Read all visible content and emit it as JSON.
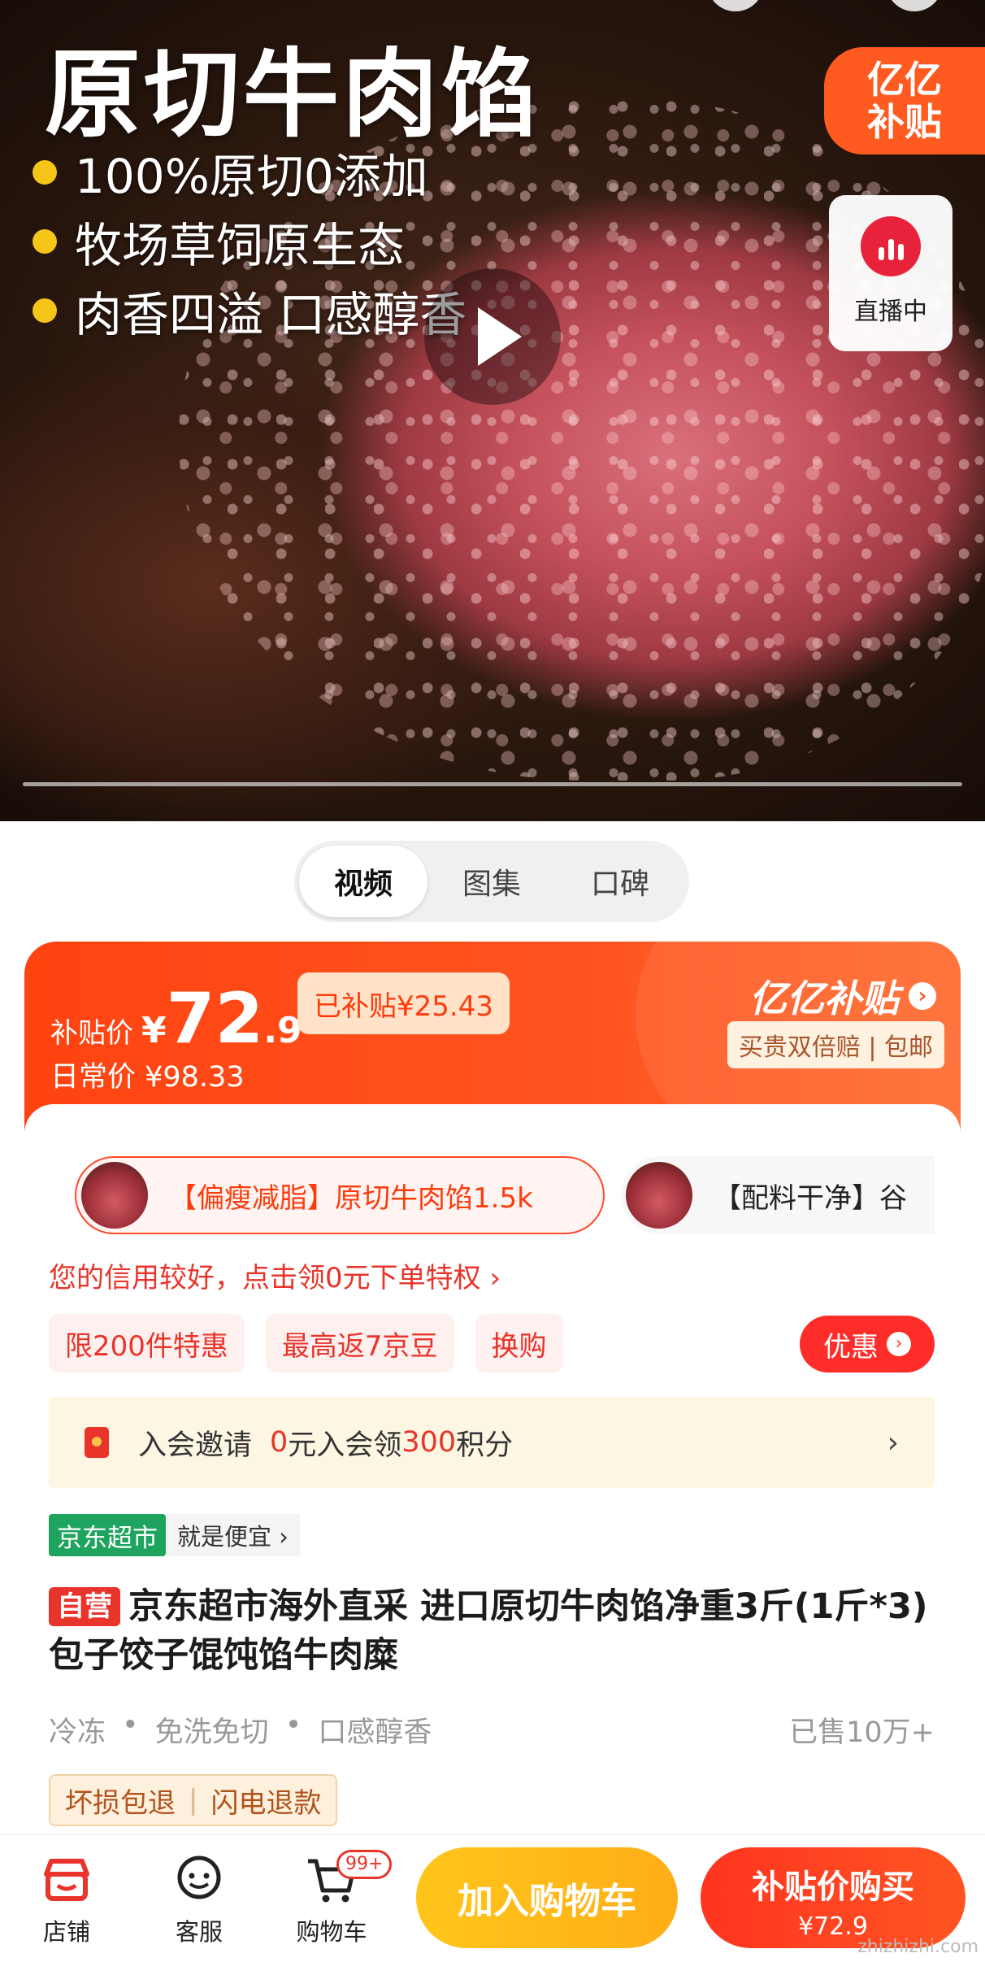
{
  "hero": {
    "title": "原切牛肉馅",
    "bullets": [
      "100%原切0添加",
      "牧场草饲原生态",
      "肉香四溢 口感醇香"
    ],
    "badge_line1": "亿亿",
    "badge_line2": "补贴",
    "live_label": "直播中"
  },
  "media_tabs": [
    "视频",
    "图集",
    "口碑"
  ],
  "price": {
    "label": "补贴价",
    "currency": "¥",
    "integer": "72",
    "decimal": ".9",
    "daily_label": "日常价 ¥98.33",
    "subsidized": "已补贴¥25.43",
    "program": "亿亿补贴",
    "program_sub": "买贵双倍赔 | 包邮"
  },
  "skus": [
    {
      "label": "【偏瘦减脂】原切牛肉馅1.5k",
      "selected": true
    },
    {
      "label": "【配料干净】谷",
      "selected": false
    }
  ],
  "credit_text": "您的信用较好，点击领0元下单特权 ›",
  "promo_tags": [
    "限200件特惠",
    "最高返7京豆",
    "换购"
  ],
  "discount_button": "优惠",
  "member": {
    "prefix": "入会邀请",
    "part1": "0",
    "part2": "元入会领",
    "part3": "300",
    "part4": "积分"
  },
  "store": {
    "name": "京东超市",
    "slogan": "就是便宜 ›"
  },
  "product": {
    "self_tag": "自营",
    "title": "京东超市海外直采 进口原切牛肉馅净重3斤(1斤*3) 包子饺子馄饨馅牛肉糜"
  },
  "features": [
    "冷冻",
    "免洗免切",
    "口感醇香"
  ],
  "sold": "已售10万+",
  "guarantees": [
    "坏损包退",
    "闪电退款"
  ],
  "bottom_nav": {
    "shop": "店铺",
    "service": "客服",
    "cart": "购物车",
    "cart_badge": "99+"
  },
  "buttons": {
    "add_cart": "加入购物车",
    "buy": "补贴价购买",
    "buy_price": "¥72.9"
  },
  "watermark": "zhizhizhi.com",
  "colors": {
    "accent": "#ff4310",
    "red": "#e8342a",
    "yellow": "#ffc51a",
    "green": "#1ea45e"
  }
}
